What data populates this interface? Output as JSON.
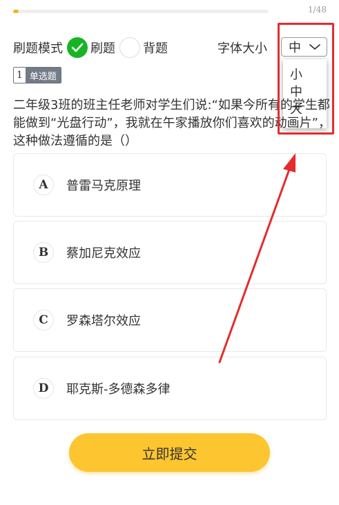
{
  "progress": {
    "current_text": "1/48",
    "fraction": 0.0208
  },
  "mode": {
    "label": "刷题模式",
    "options": [
      {
        "label": "刷题",
        "checked": true
      },
      {
        "label": "背题",
        "checked": false
      }
    ]
  },
  "font_size": {
    "label": "字体大小",
    "selected": "中",
    "options": [
      "小",
      "中",
      "大"
    ]
  },
  "question": {
    "number": "1",
    "type": "单选题",
    "text_visible": "二年级3班的班主任老师对学生们说:“如果今所有的学生都能做到“光盘行动”，我就在午家播放你们喜欢的动画片”，这种做法遵循的是（）"
  },
  "options": [
    {
      "letter": "A",
      "text": "普雷马克原理"
    },
    {
      "letter": "B",
      "text": "蔡加尼克效应"
    },
    {
      "letter": "C",
      "text": "罗森塔尔效应"
    },
    {
      "letter": "D",
      "text": "耶克斯-多德森多律"
    }
  ],
  "submit": {
    "label": "立即提交"
  },
  "colors": {
    "accent": "#fdc52f",
    "check": "#18b424",
    "annotation": "#e52b2b"
  }
}
